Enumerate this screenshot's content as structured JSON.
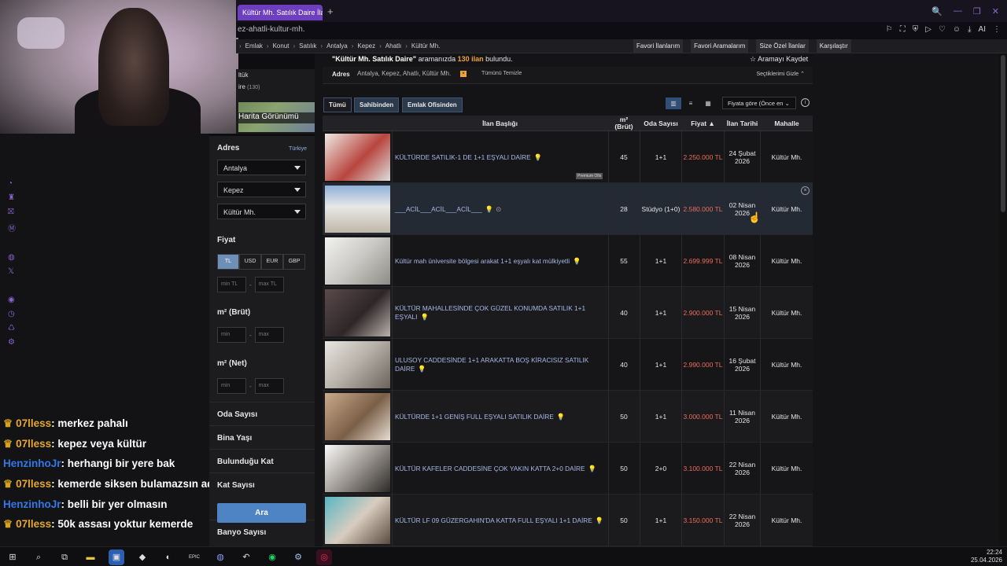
{
  "browser": {
    "tab_title": "Kültür Mh. Satılık Daire İlan",
    "tab_add": "+",
    "url": "ez-ahatli-kultur-mh.",
    "window_controls": [
      "🔍",
      "—",
      "❐",
      "✕"
    ]
  },
  "site_nav": {
    "breadcrumbs": [
      "Emlak",
      "Konut",
      "Satılık",
      "Antalya",
      "Kepez",
      "Ahatlı",
      "Kültür Mh."
    ],
    "links": [
      "Favori İlanlarım",
      "Favori Aramalarım",
      "Size Özel İlanlar",
      "Karşılaştır"
    ]
  },
  "left_sidebar_partial": {
    "line1": "ltük",
    "line2": "ire",
    "line2_count": "(130)",
    "map_view": "Harita Görünümü"
  },
  "filters": {
    "address_heading": "Adres",
    "country_link": "Türkiye",
    "province": "Antalya",
    "district": "Kepez",
    "neighborhood": "Kültür Mh.",
    "price_heading": "Fiyat",
    "currencies": [
      "TL",
      "USD",
      "EUR",
      "GBP"
    ],
    "active_currency": "TL",
    "price_min_placeholder": "min TL",
    "price_max_placeholder": "max TL",
    "gross_heading": "m² (Brüt)",
    "net_heading": "m² (Net)",
    "min_placeholder": "min",
    "max_placeholder": "max",
    "dash": "-",
    "sections": [
      "Oda Sayısı",
      "Bina Yaşı",
      "Bulunduğu Kat",
      "Kat Sayısı",
      "Banyo Sayısı"
    ],
    "search_button": "Ara"
  },
  "results": {
    "summary_query": "\"Kültür Mh. Satılık Daire\"",
    "summary_mid": " aramanızda ",
    "summary_count": "130 ilan",
    "summary_end": " bulundu.",
    "save_search": "☆ Aramayı Kaydet",
    "address_label": "Adres",
    "address_chip": "Antalya, Kepez, Ahatlı, Kültür Mh.",
    "chip_close": "×",
    "clear_all": "Tümünü Temizle",
    "hide_selected": "Seçtiklerimi Gizle ⌃",
    "tabs": [
      "Tümü",
      "Sahibinden",
      "Emlak Ofisinden"
    ],
    "sort": "Fiyata göre (Önce en ⌄",
    "info": "i",
    "headers": {
      "title": "İlan Başlığı",
      "m2": "m²",
      "m2_sub": "(Brüt)",
      "rooms": "Oda Sayısı",
      "price": "Fiyat ▲",
      "date": "İlan Tarihi",
      "district": "Mahalle"
    },
    "premium_badge": "Premium Ofis",
    "rows": [
      {
        "title": "KÜLTÜRDE SATILIK-1 DE 1+1 EŞYALI DAİRE",
        "m2": "45",
        "rooms": "1+1",
        "price": "2.250.000 TL",
        "date": "24 Şubat 2026",
        "district": "Kültür Mh."
      },
      {
        "title": "___ACİL___ACİL___ACİL___",
        "m2": "28",
        "rooms": "Stüdyo (1+0)",
        "price": "2.580.000 TL",
        "date": "02 Nisan 2026",
        "district": "Kültür Mh."
      },
      {
        "title": "Kültür mah üniversite bölgesi arakat 1+1 eşyalı kat mülkiyetli",
        "m2": "55",
        "rooms": "1+1",
        "price": "2.699.999 TL",
        "date": "08 Nisan 2026",
        "district": "Kültür Mh."
      },
      {
        "title": "KÜLTÜR MAHALLESİNDE ÇOK GÜZEL KONUMDA SATILIK 1+1 EŞYALI",
        "m2": "40",
        "rooms": "1+1",
        "price": "2.900.000 TL",
        "date": "15 Nisan 2026",
        "district": "Kültür Mh."
      },
      {
        "title": "ULUSOY CADDESİNDE 1+1 ARAKATTA BOŞ KİRACISIZ SATILIK DAİRE",
        "m2": "40",
        "rooms": "1+1",
        "price": "2.990.000 TL",
        "date": "16 Şubat 2026",
        "district": "Kültür Mh."
      },
      {
        "title": "KÜLTÜRDE 1+1 GENİŞ FULL EŞYALI SATILIK DAİRE",
        "m2": "50",
        "rooms": "1+1",
        "price": "3.000.000 TL",
        "date": "11 Nisan 2026",
        "district": "Kültür Mh."
      },
      {
        "title": "KÜLTÜR KAFELER CADDESİNE ÇOK YAKIN KATTA 2+0 DAİRE",
        "m2": "50",
        "rooms": "2+0",
        "price": "3.100.000 TL",
        "date": "22 Nisan 2026",
        "district": "Kültür Mh."
      },
      {
        "title": "KÜLTÜR LF 09 GÜZERGAHIN'DA KATTA FULL EŞYALI 1+1 DAİRE",
        "m2": "50",
        "rooms": "1+1",
        "price": "3.150.000 TL",
        "date": "22 Nisan 2026",
        "district": "Kültür Mh."
      }
    ]
  },
  "chat": [
    {
      "user": "07lless",
      "msg": ": merkez pahalı",
      "crown": true,
      "color": "#e6a52b"
    },
    {
      "user": "07lless",
      "msg": ": kepez veya kültür",
      "crown": true,
      "color": "#e6a52b"
    },
    {
      "user": "HenzinhoJr",
      "msg": ": herhangi bir yere bak",
      "crown": false,
      "color": "#2f78e6"
    },
    {
      "user": "07lless",
      "msg": ": kemerde siksen bulamazsın aq",
      "crown": true,
      "color": "#e6a52b"
    },
    {
      "user": "HenzinhoJr",
      "msg": ": belli bir yer olmasın",
      "crown": false,
      "color": "#2f78e6"
    },
    {
      "user": "07lless",
      "msg": ": 50k assası yoktur kemerde",
      "crown": true,
      "color": "#e6a52b"
    }
  ],
  "taskbar": {
    "time": "22:24",
    "date": "25.04.2026"
  }
}
